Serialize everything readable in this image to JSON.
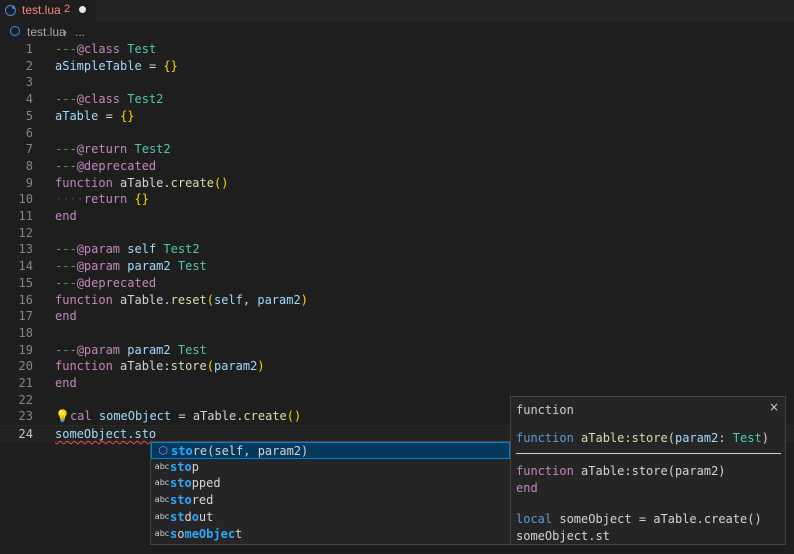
{
  "tab": {
    "filename": "test.lua",
    "error_count": "2"
  },
  "breadcrumb": {
    "file": "test.lua",
    "separator": "›",
    "ellipsis": "..."
  },
  "editor": {
    "lines": [
      {
        "n": "1"
      },
      {
        "n": "2"
      },
      {
        "n": "3"
      },
      {
        "n": "4"
      },
      {
        "n": "5"
      },
      {
        "n": "6"
      },
      {
        "n": "7"
      },
      {
        "n": "8"
      },
      {
        "n": "9"
      },
      {
        "n": "10"
      },
      {
        "n": "11"
      },
      {
        "n": "12"
      },
      {
        "n": "13"
      },
      {
        "n": "14"
      },
      {
        "n": "15"
      },
      {
        "n": "16"
      },
      {
        "n": "17"
      },
      {
        "n": "18"
      },
      {
        "n": "19"
      },
      {
        "n": "20"
      },
      {
        "n": "21"
      },
      {
        "n": "22"
      },
      {
        "n": "23"
      },
      {
        "n": "24"
      }
    ],
    "t": {
      "dashes": "---",
      "at_class": "@class",
      "at_return": "@return",
      "at_deprecated": "@deprecated",
      "at_param": "@param",
      "test": "Test",
      "test2": "Test2",
      "aSimpleTable": "aSimpleTable",
      "aTable": "aTable",
      "eq": "=",
      "lbrace": "{",
      "rbrace": "}",
      "function": "function",
      "return": "return",
      "end": "end",
      "dot": ".",
      "colon": ":",
      "create": "create",
      "reset": "reset",
      "store": "store",
      "lparen": "(",
      "rparen": ")",
      "self": "self",
      "comma": ",",
      "param2": "param2",
      "cal": "cal",
      "someObject": "someObject",
      "typed": "someObject.sto",
      "indent_dots": "····"
    }
  },
  "suggest": {
    "items": [
      {
        "icon": "⬡",
        "hl": "sto",
        "rest": "re(self, param2)"
      },
      {
        "icon": "abc",
        "hl": "sto",
        "rest": "p"
      },
      {
        "icon": "abc",
        "hl": "sto",
        "rest": "pped"
      },
      {
        "icon": "abc",
        "hl": "sto",
        "rest": "red"
      },
      {
        "icon": "abc",
        "p1": "st",
        "p2": "d",
        "p3": "o",
        "p4": "ut"
      },
      {
        "icon": "abc",
        "p1": "s",
        "p2": "o",
        "p3": "meObjec",
        "p4": "t"
      }
    ]
  },
  "details": {
    "title": "function",
    "close": "×",
    "sig_kw": "function",
    "sig_name": "aTable:store",
    "sig_lparen": "(",
    "sig_param": "param2",
    "sig_colon": ": ",
    "sig_type": "Test",
    "sig_rparen": ")",
    "code_kw": "function",
    "code_rest": "aTable:store(param2)",
    "code_end": "end",
    "code_local": "local",
    "code_obj": "someObject",
    "code_eq": "=",
    "code_call": "aTable.create()",
    "code_last": "someObject.st"
  },
  "colors": {
    "background": "#1e1e1e",
    "comment": "#6a9955",
    "type": "#4ec9b0",
    "keyword": "#c586c0",
    "variable": "#9cdcfe",
    "function": "#dcdcaa",
    "error": "#f48771",
    "accent": "#007fd4"
  }
}
